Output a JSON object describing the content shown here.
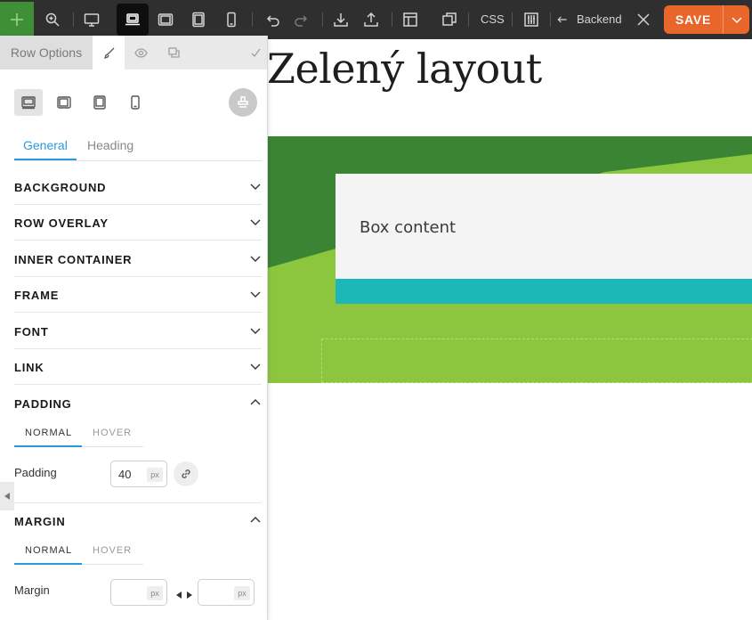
{
  "toolbar": {
    "css_label": "CSS",
    "backend_label": "Backend",
    "save_label": "SAVE",
    "icons": [
      "add-icon",
      "zoom-icon",
      "desktop-icon",
      "laptop-icon",
      "tablet-landscape-icon",
      "tablet-portrait-icon",
      "mobile-icon",
      "undo-icon",
      "redo-icon",
      "import-icon",
      "export-icon",
      "layout-icon",
      "duplicate-icon",
      "settings-sliders-icon",
      "arrow-left-icon",
      "close-icon",
      "chevron-down-icon"
    ]
  },
  "canvas": {
    "page_title": "Zelený layout",
    "box_content": "Box content",
    "colors": {
      "green_light": "#8cc63f",
      "green_dark": "#3a8433",
      "teal": "#1cb8b7",
      "box": "#f4f4f4"
    }
  },
  "panel": {
    "title": "Row Options",
    "tabs": [
      {
        "label": "General",
        "active": true
      },
      {
        "label": "Heading",
        "active": false
      }
    ],
    "sections": [
      {
        "label": "BACKGROUND",
        "expanded": false
      },
      {
        "label": "ROW OVERLAY",
        "expanded": false
      },
      {
        "label": "INNER CONTAINER",
        "expanded": false
      },
      {
        "label": "FRAME",
        "expanded": false
      },
      {
        "label": "FONT",
        "expanded": false
      },
      {
        "label": "LINK",
        "expanded": false
      },
      {
        "label": "PADDING",
        "expanded": true
      },
      {
        "label": "MARGIN",
        "expanded": true
      }
    ],
    "padding": {
      "states": [
        "NORMAL",
        "HOVER"
      ],
      "label": "Padding",
      "value": "40",
      "unit": "px"
    },
    "margin": {
      "states": [
        "NORMAL",
        "HOVER"
      ],
      "label": "Margin",
      "value_1": "",
      "value_2": "",
      "unit": "px"
    },
    "accent_color": "#2a9bd8"
  }
}
